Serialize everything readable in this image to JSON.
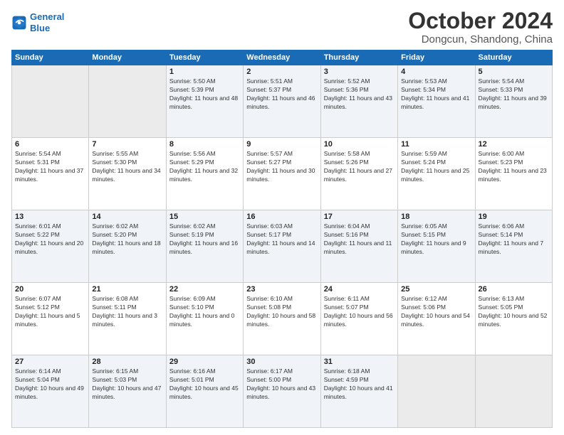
{
  "header": {
    "logo_line1": "General",
    "logo_line2": "Blue",
    "title": "October 2024",
    "location": "Dongcun, Shandong, China"
  },
  "weekdays": [
    "Sunday",
    "Monday",
    "Tuesday",
    "Wednesday",
    "Thursday",
    "Friday",
    "Saturday"
  ],
  "weeks": [
    [
      {
        "day": "",
        "info": ""
      },
      {
        "day": "",
        "info": ""
      },
      {
        "day": "1",
        "info": "Sunrise: 5:50 AM\nSunset: 5:39 PM\nDaylight: 11 hours and 48 minutes."
      },
      {
        "day": "2",
        "info": "Sunrise: 5:51 AM\nSunset: 5:37 PM\nDaylight: 11 hours and 46 minutes."
      },
      {
        "day": "3",
        "info": "Sunrise: 5:52 AM\nSunset: 5:36 PM\nDaylight: 11 hours and 43 minutes."
      },
      {
        "day": "4",
        "info": "Sunrise: 5:53 AM\nSunset: 5:34 PM\nDaylight: 11 hours and 41 minutes."
      },
      {
        "day": "5",
        "info": "Sunrise: 5:54 AM\nSunset: 5:33 PM\nDaylight: 11 hours and 39 minutes."
      }
    ],
    [
      {
        "day": "6",
        "info": "Sunrise: 5:54 AM\nSunset: 5:31 PM\nDaylight: 11 hours and 37 minutes."
      },
      {
        "day": "7",
        "info": "Sunrise: 5:55 AM\nSunset: 5:30 PM\nDaylight: 11 hours and 34 minutes."
      },
      {
        "day": "8",
        "info": "Sunrise: 5:56 AM\nSunset: 5:29 PM\nDaylight: 11 hours and 32 minutes."
      },
      {
        "day": "9",
        "info": "Sunrise: 5:57 AM\nSunset: 5:27 PM\nDaylight: 11 hours and 30 minutes."
      },
      {
        "day": "10",
        "info": "Sunrise: 5:58 AM\nSunset: 5:26 PM\nDaylight: 11 hours and 27 minutes."
      },
      {
        "day": "11",
        "info": "Sunrise: 5:59 AM\nSunset: 5:24 PM\nDaylight: 11 hours and 25 minutes."
      },
      {
        "day": "12",
        "info": "Sunrise: 6:00 AM\nSunset: 5:23 PM\nDaylight: 11 hours and 23 minutes."
      }
    ],
    [
      {
        "day": "13",
        "info": "Sunrise: 6:01 AM\nSunset: 5:22 PM\nDaylight: 11 hours and 20 minutes."
      },
      {
        "day": "14",
        "info": "Sunrise: 6:02 AM\nSunset: 5:20 PM\nDaylight: 11 hours and 18 minutes."
      },
      {
        "day": "15",
        "info": "Sunrise: 6:02 AM\nSunset: 5:19 PM\nDaylight: 11 hours and 16 minutes."
      },
      {
        "day": "16",
        "info": "Sunrise: 6:03 AM\nSunset: 5:17 PM\nDaylight: 11 hours and 14 minutes."
      },
      {
        "day": "17",
        "info": "Sunrise: 6:04 AM\nSunset: 5:16 PM\nDaylight: 11 hours and 11 minutes."
      },
      {
        "day": "18",
        "info": "Sunrise: 6:05 AM\nSunset: 5:15 PM\nDaylight: 11 hours and 9 minutes."
      },
      {
        "day": "19",
        "info": "Sunrise: 6:06 AM\nSunset: 5:14 PM\nDaylight: 11 hours and 7 minutes."
      }
    ],
    [
      {
        "day": "20",
        "info": "Sunrise: 6:07 AM\nSunset: 5:12 PM\nDaylight: 11 hours and 5 minutes."
      },
      {
        "day": "21",
        "info": "Sunrise: 6:08 AM\nSunset: 5:11 PM\nDaylight: 11 hours and 3 minutes."
      },
      {
        "day": "22",
        "info": "Sunrise: 6:09 AM\nSunset: 5:10 PM\nDaylight: 11 hours and 0 minutes."
      },
      {
        "day": "23",
        "info": "Sunrise: 6:10 AM\nSunset: 5:08 PM\nDaylight: 10 hours and 58 minutes."
      },
      {
        "day": "24",
        "info": "Sunrise: 6:11 AM\nSunset: 5:07 PM\nDaylight: 10 hours and 56 minutes."
      },
      {
        "day": "25",
        "info": "Sunrise: 6:12 AM\nSunset: 5:06 PM\nDaylight: 10 hours and 54 minutes."
      },
      {
        "day": "26",
        "info": "Sunrise: 6:13 AM\nSunset: 5:05 PM\nDaylight: 10 hours and 52 minutes."
      }
    ],
    [
      {
        "day": "27",
        "info": "Sunrise: 6:14 AM\nSunset: 5:04 PM\nDaylight: 10 hours and 49 minutes."
      },
      {
        "day": "28",
        "info": "Sunrise: 6:15 AM\nSunset: 5:03 PM\nDaylight: 10 hours and 47 minutes."
      },
      {
        "day": "29",
        "info": "Sunrise: 6:16 AM\nSunset: 5:01 PM\nDaylight: 10 hours and 45 minutes."
      },
      {
        "day": "30",
        "info": "Sunrise: 6:17 AM\nSunset: 5:00 PM\nDaylight: 10 hours and 43 minutes."
      },
      {
        "day": "31",
        "info": "Sunrise: 6:18 AM\nSunset: 4:59 PM\nDaylight: 10 hours and 41 minutes."
      },
      {
        "day": "",
        "info": ""
      },
      {
        "day": "",
        "info": ""
      }
    ]
  ]
}
